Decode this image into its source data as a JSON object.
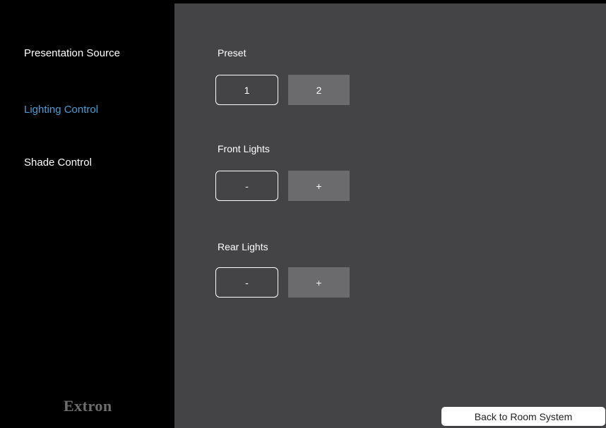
{
  "sidebar": {
    "items": [
      {
        "label": "Presentation Source",
        "active": false
      },
      {
        "label": "Lighting Control",
        "active": true
      },
      {
        "label": "Shade Control",
        "active": false
      }
    ],
    "logo": "Extron"
  },
  "main": {
    "preset": {
      "label": "Preset",
      "buttons": [
        "1",
        "2"
      ]
    },
    "front_lights": {
      "label": "Front Lights",
      "buttons": [
        "-",
        "+"
      ]
    },
    "rear_lights": {
      "label": "Rear Lights",
      "buttons": [
        "-",
        "+"
      ]
    },
    "back_button": "Back to Room System"
  },
  "colors": {
    "sidebar_bg": "#000000",
    "main_bg": "#444446",
    "active_nav": "#4a9ed6",
    "filled_button": "#6b6b6d",
    "logo": "#6e6e6e"
  }
}
